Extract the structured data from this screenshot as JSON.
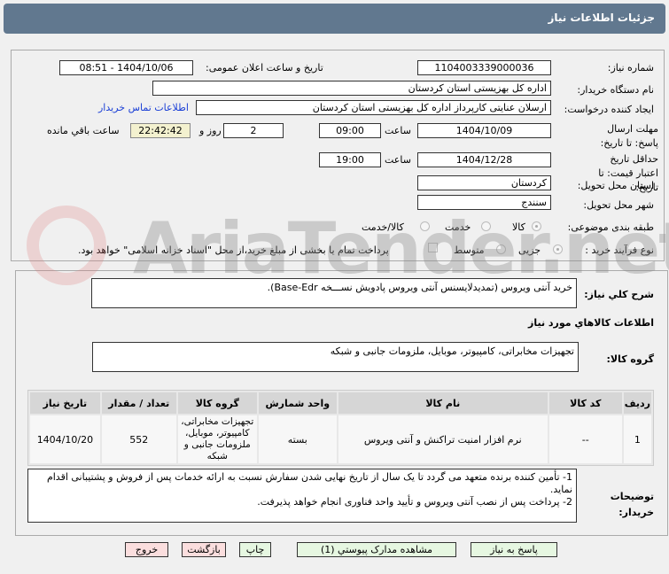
{
  "header": {
    "title": "جزئیات اطلاعات نیاز"
  },
  "watermark": "AriaTender.net",
  "form": {
    "need_number_label": "شماره نیاز:",
    "need_number": "1104003339000036",
    "announce_label": "تاریخ و ساعت اعلان عمومی:",
    "announce_value": "1404/10/06 - 08:51",
    "buyer_label": "نام دستگاه خریدار:",
    "buyer": "اداره کل بهزیستی استان کردستان",
    "creator_label": "ایجاد کننده درخواست:",
    "creator": "ارسلان  عنایتی کارپرداز اداره کل بهزیستی استان کردستان",
    "contact_link": "اطلاعات تماس خریدار",
    "deadline_label": "مهلت ارسال پاسخ: تا تاریخ:",
    "deadline_date": "1404/10/09",
    "time_label": "ساعت",
    "deadline_time": "09:00",
    "days": "2",
    "days_label": "روز و",
    "remaining": "22:42:42",
    "remaining_label": "ساعت باقي مانده",
    "validity_label": "حداقل تاریخ اعتبار قیمت: تا تاریخ:",
    "validity_date": "1404/12/28",
    "validity_time": "19:00",
    "province_label": "استان محل تحویل:",
    "province": "کردستان",
    "city_label": "شهر محل تحویل:",
    "city": "سنندج",
    "category_label": "طبقه بندی موضوعی:",
    "category_options": [
      "کالا",
      "خدمت",
      "کالا/خدمت"
    ],
    "category_selected": "کالا",
    "process_label": "نوع فرآیند خرید :",
    "process_options": [
      "جزیی",
      "متوسط"
    ],
    "process_selected": "جزیی",
    "payment_note": "پرداخت تمام یا بخشی از مبلغ خرید،از محل \"اسناد خزانه اسلامی\" خواهد بود."
  },
  "details": {
    "description_label": "شرح کلي نیاز:",
    "description": "خرید آنتی ویروس (تمدیدلایسنس آنتی ویروس پادویش نســـخه Base-Edr).",
    "goods_title": "اطلاعات کالاهاي مورد نیاز",
    "group_label": "گروه کالا:",
    "group": "تجهیزات مخابراتی، کامپیوتر، موبایل، ملزومات جانبی و شبکه",
    "table": {
      "headers": [
        "ردیف",
        "کد کالا",
        "نام کالا",
        "واحد شمارش",
        "گروه کالا",
        "تعداد / مقدار",
        "تاریخ نیاز"
      ],
      "rows": [
        [
          "1",
          "--",
          "نرم افزار امنیت تراکنش و آنتی ویروس",
          "بسته",
          "تجهیزات مخابراتی، کامپیوتر، موبایل، ملزومات جانبی و شبکه",
          "552",
          "1404/10/20"
        ]
      ]
    },
    "notes_label": "توضیحات خریدار:",
    "notes": [
      "1- تأمین کننده برنده متعهد می گردد تا یک سال از تاریخ نهایی شدن سفارش نسبت به ارائه خدمات پس از فروش و پشتیبانی اقدام نماید.",
      "2- پرداخت پس از نصب آنتی ویروس و تأیید واحد فناوری انجام خواهد پذیرفت."
    ]
  },
  "buttons": {
    "reply": "پاسخ به نیاز",
    "view_docs": "مشاهده مدارک پیوستي (1)",
    "print": "چاپ",
    "back": "بازگشت",
    "exit": "خروج"
  }
}
